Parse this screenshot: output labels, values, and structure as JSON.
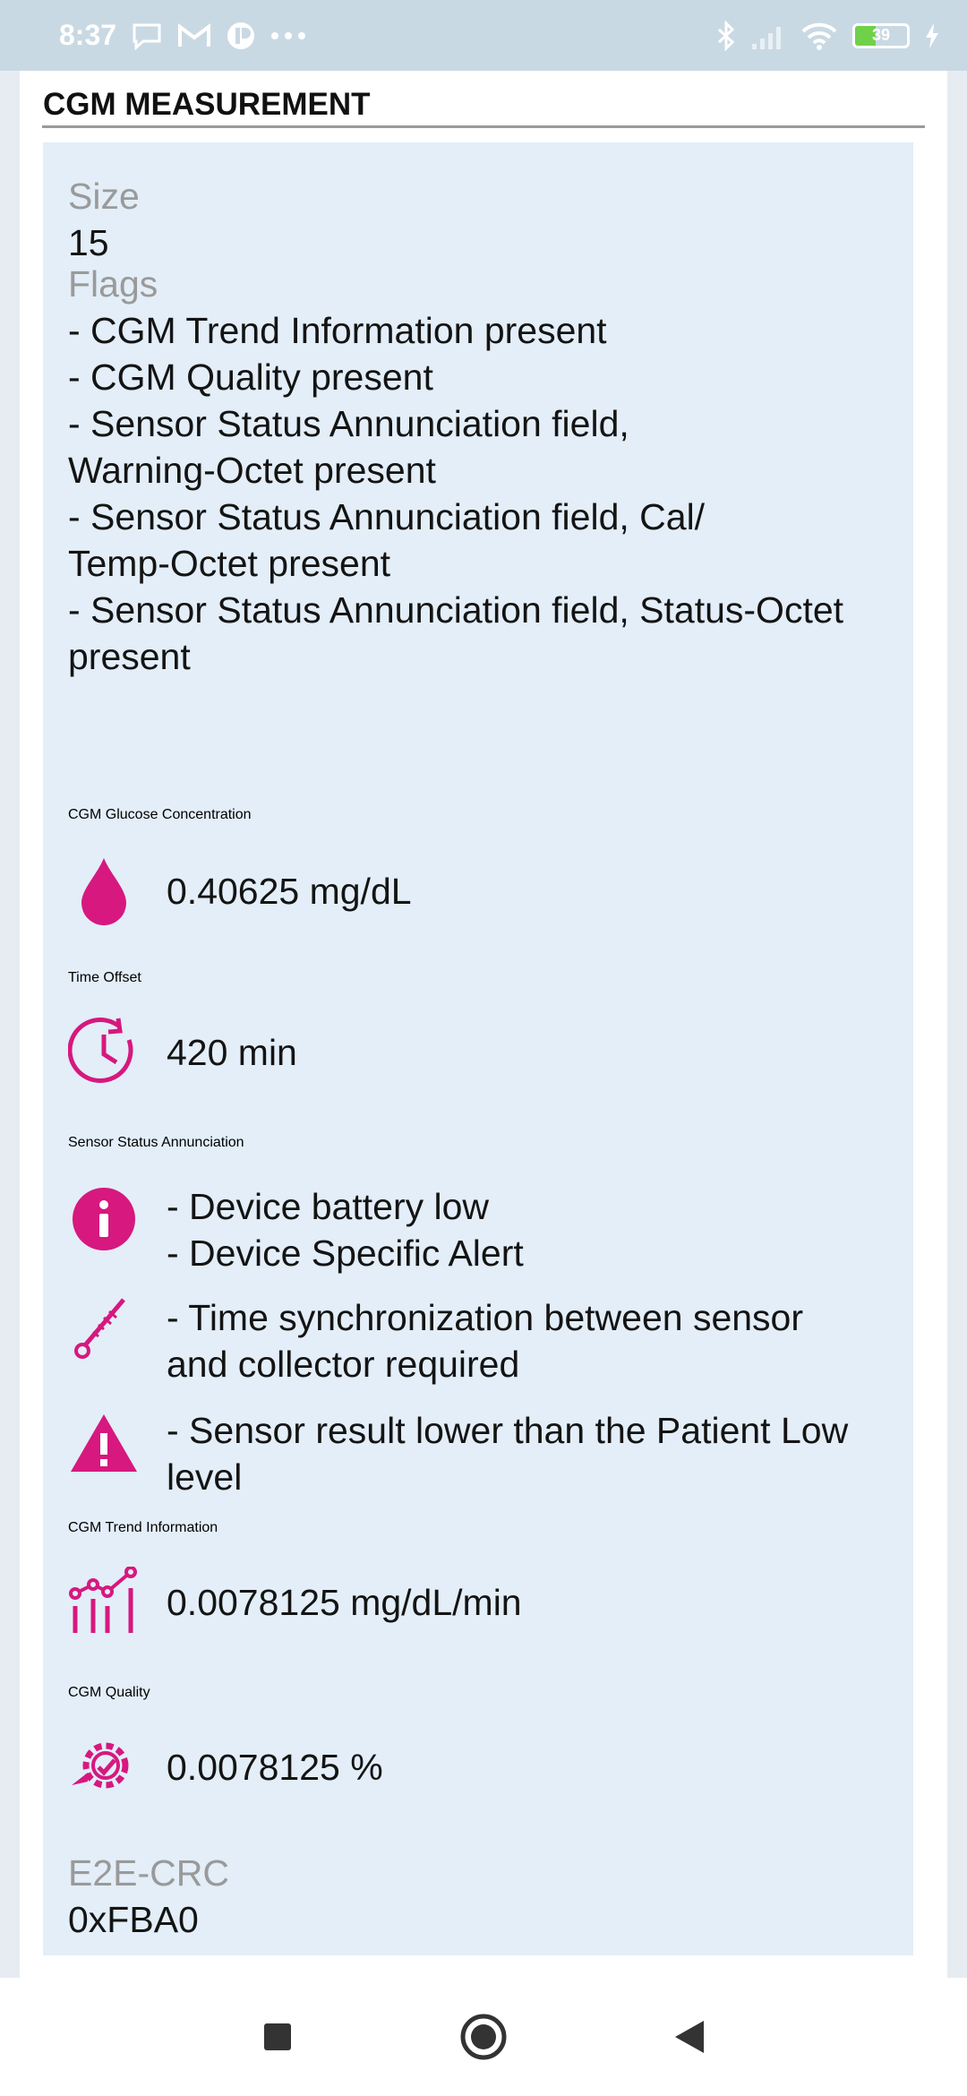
{
  "status_bar": {
    "time": "8:37",
    "battery": "39",
    "icons": [
      "chat-bubble-icon",
      "gmail-icon",
      "app-icon",
      "more-dots-icon",
      "bluetooth-icon",
      "signal-icon",
      "wifi-icon",
      "battery-icon",
      "charging-icon"
    ]
  },
  "section": {
    "title": "CGM MEASUREMENT"
  },
  "size": {
    "label": "Size",
    "value": "15"
  },
  "flags": {
    "label": "Flags",
    "items": [
      "- CGM Trend Information present",
      "- CGM Quality present",
      "- Sensor Status Annunciation field,",
      "Warning-Octet present",
      "- Sensor Status Annunciation field, Cal/",
      "Temp-Octet present",
      "- Sensor Status Annunciation field, Status-Octet",
      "present"
    ]
  },
  "glucose": {
    "label": "CGM Glucose Concentration",
    "value": "0.40625 mg/dL",
    "icon": "droplet-icon"
  },
  "time_offset": {
    "label": "Time Offset",
    "value": "420 min",
    "icon": "clock-icon"
  },
  "sensor_status": {
    "label": "Sensor Status Annunciation",
    "groups": [
      {
        "icon": "info-icon",
        "lines": [
          "- Device battery low",
          "- Device Specific Alert"
        ]
      },
      {
        "icon": "thermometer-icon",
        "lines": [
          "- Time synchronization between sensor",
          "and collector required"
        ]
      },
      {
        "icon": "warning-icon",
        "lines": [
          "- Sensor result lower than the Patient Low",
          "level"
        ]
      }
    ]
  },
  "trend": {
    "label": "CGM Trend Information",
    "value": "0.0078125 mg/dL/min",
    "icon": "trend-chart-icon"
  },
  "quality": {
    "label": "CGM Quality",
    "value": "0.0078125 %",
    "icon": "quality-gear-icon"
  },
  "crc": {
    "label": "E2E-CRC",
    "value": "0xFBA0"
  },
  "colors": {
    "accent": "#d6187f",
    "panel": "#e3eef8",
    "label": "#9a9a9a"
  }
}
